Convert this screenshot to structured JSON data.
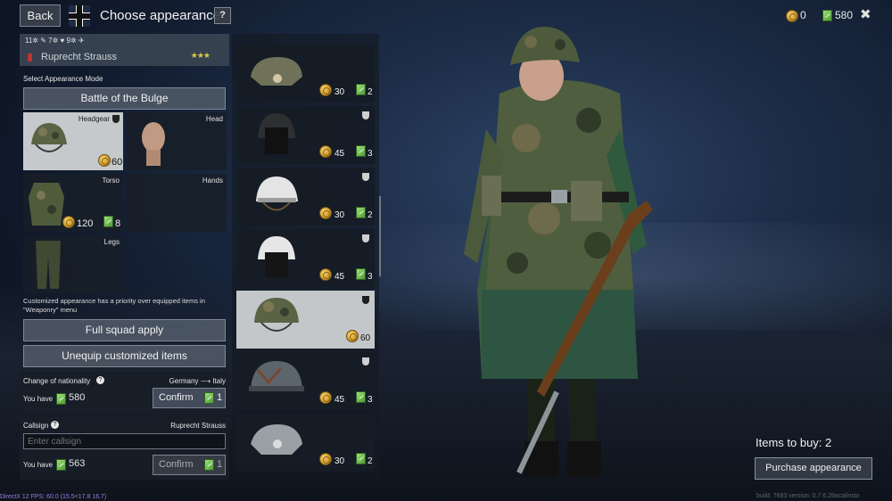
{
  "header": {
    "back_label": "Back",
    "title": "Choose appearance",
    "help_label": "?",
    "gold": "0",
    "tickets": "580",
    "close_label": "✖"
  },
  "soldier": {
    "stats": "11✲ ✎ 7✲ ♥ 9✲ ✈",
    "name": "Ruprecht Strauss",
    "stars": "★★★"
  },
  "appearance": {
    "mode_label": "Select Appearance Mode",
    "mode_value": "Battle of the Bulge",
    "slots": [
      {
        "label": "Headgear",
        "gold": "60"
      },
      {
        "label": "Head"
      },
      {
        "label": "Torso",
        "gold": "120",
        "tickets": "8"
      },
      {
        "label": "Hands"
      },
      {
        "label": "Legs"
      }
    ],
    "info": "Customized appearance has a priority over equipped items in \"Weaponry\" menu",
    "full_squad_label": "Full squad apply",
    "unequip_label": "Unequip customized items"
  },
  "nationality": {
    "label": "Change of nationality",
    "help": "?",
    "from_to": "Germany ⟶ Italy",
    "you_have_label": "You have",
    "you_have_value": "580",
    "confirm_label": "Confirm",
    "cost": "1"
  },
  "callsign": {
    "label": "Callsign",
    "help": "?",
    "name": "Ruprecht Strauss",
    "placeholder": "Enter callsign",
    "you_have_label": "You have",
    "you_have_value": "563",
    "confirm_label": "Confirm",
    "cost": "1"
  },
  "items": [
    {
      "name": "field-cap",
      "gold": "30",
      "tickets": "2"
    },
    {
      "name": "dark-helmet",
      "gold": "45",
      "tickets": "3"
    },
    {
      "name": "white-helmet",
      "gold": "30",
      "tickets": "2"
    },
    {
      "name": "white-helmet-mask",
      "gold": "45",
      "tickets": "3"
    },
    {
      "name": "camo-helmet",
      "gold": "60",
      "selected": true
    },
    {
      "name": "steel-helmet",
      "gold": "45",
      "tickets": "3"
    },
    {
      "name": "grey-field-cap",
      "gold": "30",
      "tickets": "2"
    }
  ],
  "purchase": {
    "items_to_buy": "Items to buy: 2",
    "button_label": "Purchase appearance"
  },
  "footer": {
    "build": "build: 7683 version: 0.7.6.29acalinsto",
    "fps": "DirectX 12 FPS: 60.0 (15.5<17.8 16.7)"
  },
  "colors": {
    "panel": "#18202b",
    "selected": "#c6c9cc",
    "gold": "#d8a52f",
    "ticket": "#6fbf4c"
  }
}
